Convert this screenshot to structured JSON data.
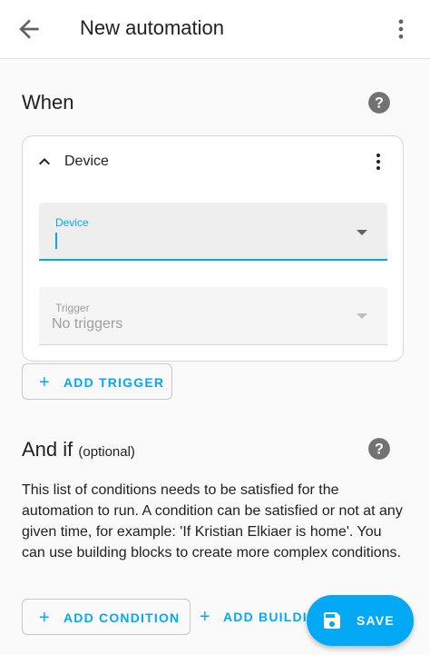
{
  "appbar": {
    "title": "New automation"
  },
  "when": {
    "heading": "When",
    "trigger_card": {
      "title": "Device",
      "device_field": {
        "label": "Device",
        "value": ""
      },
      "trigger_field": {
        "label": "Trigger",
        "value": "No triggers"
      }
    },
    "add_trigger_label": "ADD TRIGGER"
  },
  "and_if": {
    "heading": "And if",
    "optional_label": "(optional)",
    "description": "This list of conditions needs to be satisfied for the automation to run. A condition can be satisfied or not at any given time, for example: 'If Kristian Elkiaer is home'. You can use building blocks to create more complex conditions.",
    "add_condition_label": "ADD CONDITION",
    "add_building_block_label": "ADD BUILDING BLOCK"
  },
  "fab": {
    "save_label": "SAVE"
  },
  "colors": {
    "accent": "#03a9f4",
    "icon_gray": "#616161",
    "help_gray": "#727272"
  },
  "icons": [
    "arrow-left-icon",
    "more-vert-icon",
    "help-icon",
    "chevron-up-icon",
    "caret-down-icon",
    "plus-icon",
    "save-icon"
  ]
}
